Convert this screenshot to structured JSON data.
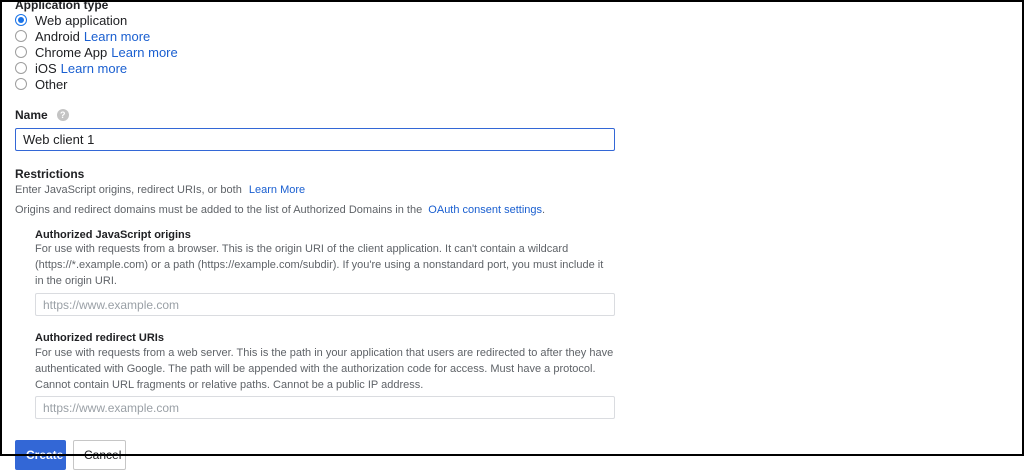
{
  "application_type": {
    "title": "Application type",
    "options": [
      {
        "label": "Web application",
        "link": "",
        "checked": true
      },
      {
        "label": "Android",
        "link": "Learn more",
        "checked": false
      },
      {
        "label": "Chrome App",
        "link": "Learn more",
        "checked": false
      },
      {
        "label": "iOS",
        "link": "Learn more",
        "checked": false
      },
      {
        "label": "Other",
        "link": "",
        "checked": false
      }
    ]
  },
  "name": {
    "label": "Name",
    "help_icon": "?",
    "value": "Web client 1"
  },
  "restrictions": {
    "title": "Restrictions",
    "description": "Enter JavaScript origins, redirect URIs, or both",
    "description_link": "Learn More",
    "domains_text": "Origins and redirect domains must be added to the list of Authorized Domains in the",
    "domains_link": "OAuth consent settings",
    "domains_end": "."
  },
  "js_origins": {
    "title": "Authorized JavaScript origins",
    "description_lines": [
      "For use with requests from a browser. This is the origin URI of the client application. It can't contain a wildcard",
      "(https://*.example.com) or a path (https://example.com/subdir). If you're using a nonstandard port, you must include it",
      "in the origin URI."
    ],
    "placeholder": "https://www.example.com"
  },
  "redirect_uris": {
    "title": "Authorized redirect URIs",
    "description_lines": [
      "For use with requests from a web server. This is the path in your application that users are redirected to after they have",
      "authenticated with Google. The path will be appended with the authorization code for access. Must have a protocol.",
      "Cannot contain URL fragments or relative paths. Cannot be a public IP address."
    ],
    "placeholder": "https://www.example.com"
  },
  "buttons": {
    "create": "Create",
    "cancel": "Cancel"
  },
  "colors": {
    "accent": "#1a73e8",
    "link": "#1a5fd0",
    "primary_button": "#3367d6"
  }
}
